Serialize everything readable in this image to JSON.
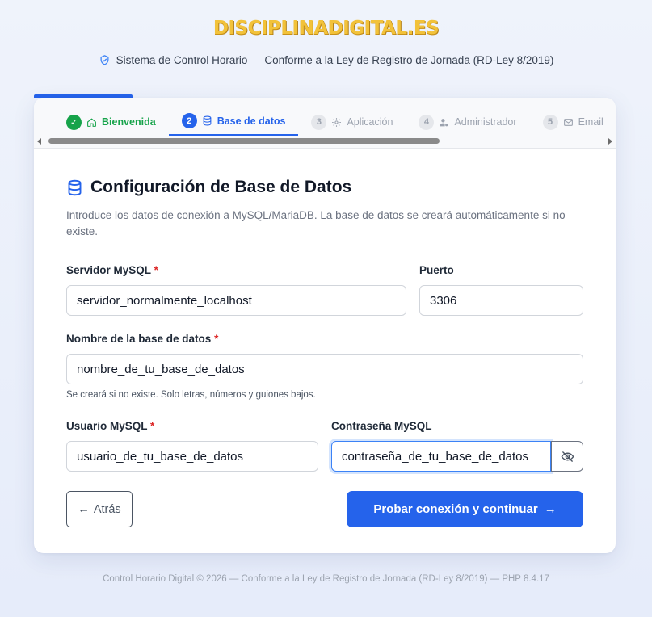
{
  "brand": {
    "logo_text": "DISCIPLINADIGITAL.ES",
    "logo_color": "#f2c23a"
  },
  "header": {
    "subtitle": "Sistema de Control Horario — Conforme a la Ley de Registro de Jornada (RD-Ley 8/2019)"
  },
  "steps": [
    {
      "num": "✓",
      "label": "Bienvenida",
      "icon": "home-icon",
      "state": "done"
    },
    {
      "num": "2",
      "label": "Base de datos",
      "icon": "database-icon",
      "state": "active"
    },
    {
      "num": "3",
      "label": "Aplicación",
      "icon": "gear-icon",
      "state": "pending"
    },
    {
      "num": "4",
      "label": "Administrador",
      "icon": "user-icon",
      "state": "pending"
    },
    {
      "num": "5",
      "label": "Email",
      "icon": "mail-icon",
      "state": "pending"
    }
  ],
  "form": {
    "title": "Configuración de Base de Datos",
    "description": "Introduce los datos de conexión a MySQL/MariaDB. La base de datos se creará automáticamente si no existe.",
    "required_mark": "*",
    "server": {
      "label": "Servidor MySQL",
      "value": "servidor_normalmente_localhost"
    },
    "port": {
      "label": "Puerto",
      "value": "3306"
    },
    "dbname": {
      "label": "Nombre de la base de datos",
      "value": "nombre_de_tu_base_de_datos",
      "hint": "Se creará si no existe. Solo letras, números y guiones bajos."
    },
    "user": {
      "label": "Usuario MySQL",
      "value": "usuario_de_tu_base_de_datos"
    },
    "password": {
      "label": "Contraseña MySQL",
      "value": "contraseña_de_tu_base_de_datos"
    },
    "back_label": "Atrás",
    "submit_label": "Probar conexión y continuar"
  },
  "footer": {
    "text": "Control Horario Digital © 2026 — Conforme a la Ley de Registro de Jornada (RD-Ley 8/2019) — PHP 8.4.17"
  },
  "colors": {
    "primary": "#2563eb",
    "success": "#16a34a",
    "required": "#dc2626"
  }
}
